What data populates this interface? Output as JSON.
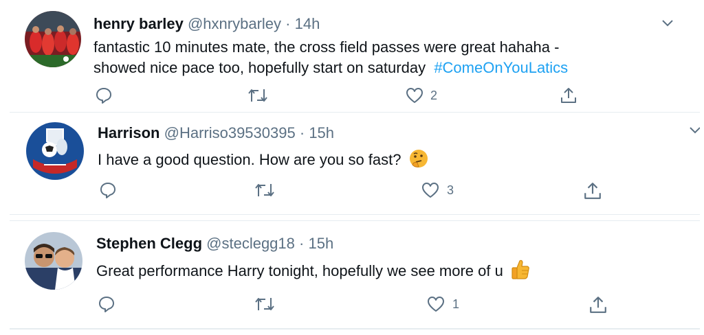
{
  "tweets": [
    {
      "name": "henry barley",
      "handle": "@hxnrybarley",
      "separator": "·",
      "time": "14h",
      "line1": "fantastic 10 minutes mate, the cross field passes were great hahaha -",
      "line2": "showed nice pace too, hopefully start on saturday",
      "hashtag": "#ComeOnYouLatics",
      "like_count": "2",
      "avatar_icon": "team-photo-avatar"
    },
    {
      "name": "Harrison",
      "handle": "@Harriso39530395",
      "separator": "·",
      "time": "15h",
      "line1": "I have a good question. How are you so fast?",
      "emoji_icon": "thinking-face-icon",
      "like_count": "3",
      "avatar_icon": "club-crest-avatar"
    },
    {
      "name": "Stephen Clegg",
      "handle": "@steclegg18",
      "separator": "·",
      "time": "15h",
      "line1": "Great performance Harry tonight, hopefully we see more of u",
      "emoji_icon": "thumbs-up-icon",
      "like_count": "1",
      "avatar_icon": "selfie-avatar"
    }
  ],
  "colors": {
    "text": "#0f1419",
    "secondary": "#5b7083",
    "link": "#1da1f2",
    "divider": "#e6ecf0"
  }
}
